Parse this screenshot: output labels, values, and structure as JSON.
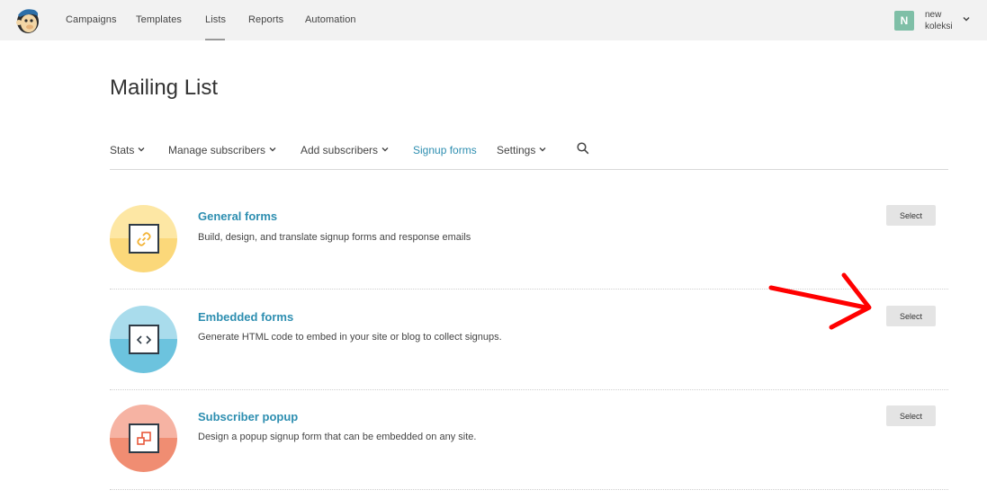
{
  "topnav": {
    "items": [
      "Campaigns",
      "Templates",
      "Lists",
      "Reports",
      "Automation"
    ],
    "active": "Lists",
    "account": {
      "initial": "N",
      "line1": "new",
      "line2": "koleksi"
    }
  },
  "page": {
    "title": "Mailing List"
  },
  "subnav": {
    "items": [
      {
        "label": "Stats",
        "has_dropdown": true
      },
      {
        "label": "Manage subscribers",
        "has_dropdown": true
      },
      {
        "label": "Add subscribers",
        "has_dropdown": true
      },
      {
        "label": "Signup forms",
        "has_dropdown": false,
        "active": true
      },
      {
        "label": "Settings",
        "has_dropdown": true
      }
    ]
  },
  "forms": [
    {
      "title": "General forms",
      "description": "Build, design, and translate signup forms and response emails",
      "button": "Select",
      "icon": "link-icon",
      "colors": {
        "top": "#fde7a4",
        "bottom": "#fbd87a",
        "glyph": "#f2b233"
      }
    },
    {
      "title": "Embedded forms",
      "description": "Generate HTML code to embed in your site or blog to collect signups.",
      "button": "Select",
      "icon": "code-icon",
      "colors": {
        "top": "#a9dcec",
        "bottom": "#6cc3de",
        "glyph": "#2f3b46"
      }
    },
    {
      "title": "Subscriber popup",
      "description": "Design a popup signup form that can be embedded on any site.",
      "button": "Select",
      "icon": "popup-icon",
      "colors": {
        "top": "#f6b3a3",
        "bottom": "#f08d72",
        "glyph": "#e8593c"
      }
    }
  ],
  "annotation": {
    "arrow_color": "#ff0000"
  }
}
